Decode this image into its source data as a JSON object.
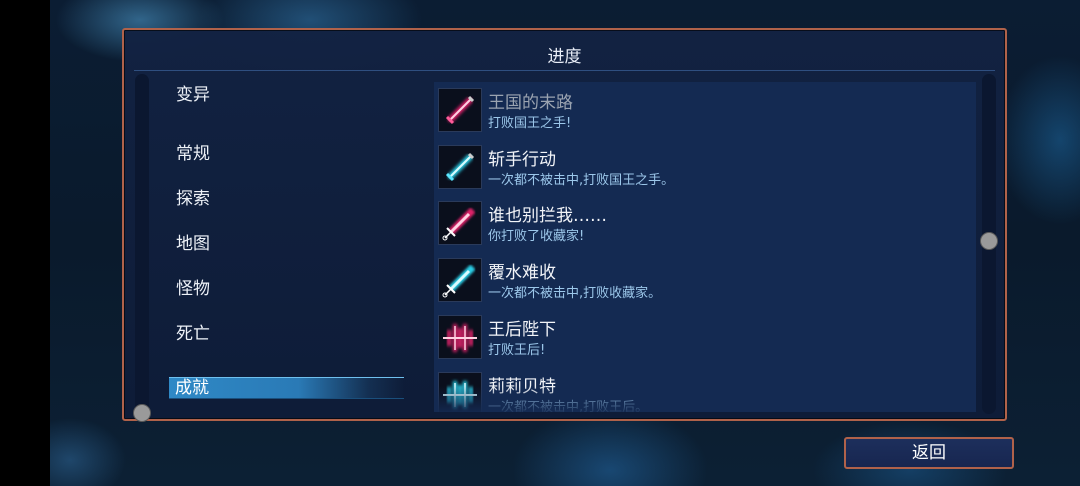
{
  "panel": {
    "title": "进度"
  },
  "categories": [
    {
      "label": "变异"
    },
    {
      "label": "常规"
    },
    {
      "label": "探索"
    },
    {
      "label": "地图"
    },
    {
      "label": "怪物"
    },
    {
      "label": "死亡"
    },
    {
      "label": "成就",
      "selected": true
    }
  ],
  "achievements": [
    {
      "name": "王国的末路",
      "desc": "打败国王之手!",
      "icon": "sword-icon",
      "color": "#e0206a",
      "dim": true
    },
    {
      "name": "斩手行动",
      "desc": "一次都不被击中,打败国王之手。",
      "icon": "sword-icon",
      "color": "#2ad0e8"
    },
    {
      "name": "谁也别拦我……",
      "desc": "你打败了收藏家!",
      "icon": "syringe-icon",
      "color": "#e0206a"
    },
    {
      "name": "覆水难收",
      "desc": "一次都不被击中,打败收藏家。",
      "icon": "syringe-icon",
      "color": "#2ad0e8"
    },
    {
      "name": "王后陛下",
      "desc": "打败王后!",
      "icon": "wave-icon",
      "color": "#e0206a"
    },
    {
      "name": "莉莉贝特",
      "desc": "一次都不被击中,打败王后。",
      "icon": "wave-icon",
      "color": "#2ad0e8"
    }
  ],
  "back_button": {
    "label": "返回"
  }
}
